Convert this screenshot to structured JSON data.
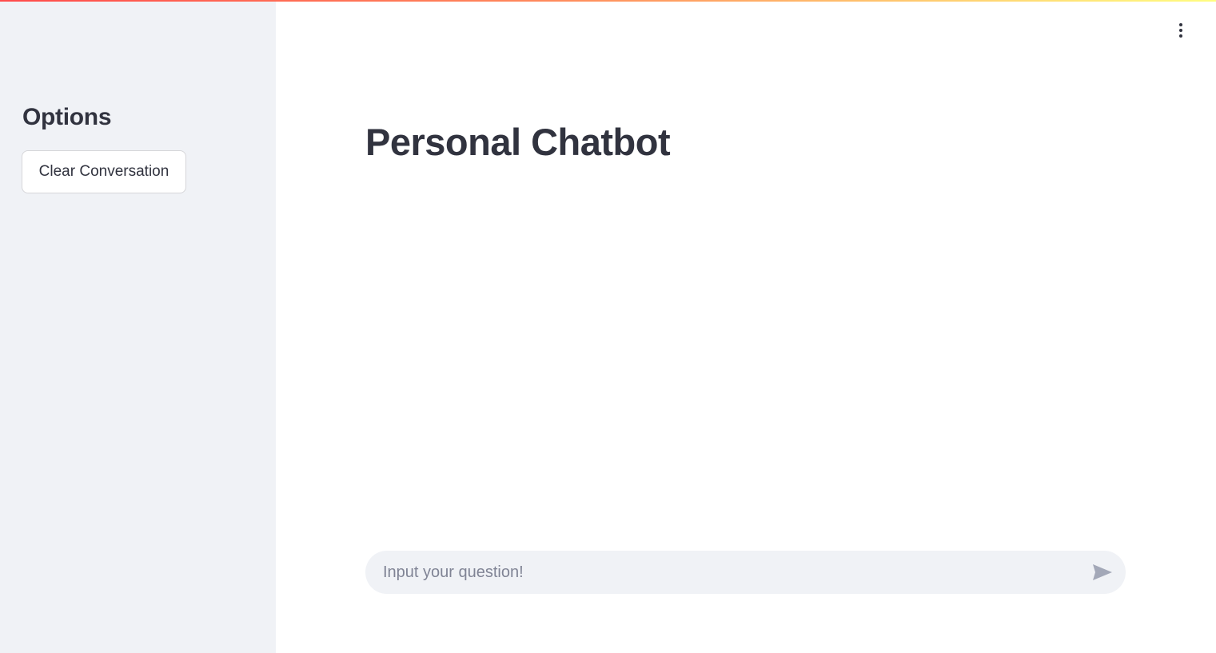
{
  "sidebar": {
    "title": "Options",
    "clear_button_label": "Clear Conversation"
  },
  "main": {
    "title": "Personal Chatbot",
    "chat_input": {
      "value": "",
      "placeholder": "Input your question!"
    }
  },
  "icons": {
    "menu": "vertical-ellipsis-icon",
    "send": "send-icon"
  },
  "colors": {
    "sidebar_bg": "#f0f2f6",
    "text": "#31333f",
    "placeholder": "#808495",
    "send_icon": "#a3a8b8",
    "accent_gradient_start": "#ff4b4b",
    "accent_gradient_end": "#fffd80"
  }
}
